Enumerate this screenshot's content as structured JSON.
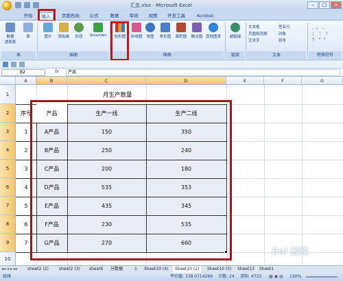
{
  "window": {
    "title": "汇总.xlsx - Microsoft Excel"
  },
  "ribbon_tabs": [
    "开始",
    "插入",
    "页面布局",
    "公式",
    "数据",
    "审阅",
    "视图",
    "开发工具",
    "Acrobat"
  ],
  "ribbon_buttons": {
    "pivot": "数据\n透视表",
    "table": "表",
    "picture": "图片",
    "clipart": "剪贴画",
    "shapes": "形状",
    "smartart": "SmartArt",
    "column": "柱形图",
    "line": "折线图",
    "pie": "饼图",
    "bar": "条形图",
    "area": "面积图",
    "scatter": "散点图",
    "other": "其他图表",
    "hyperlink": "超链接",
    "textbox": "文本框",
    "headerfooter": "页眉和页脚",
    "wordart": "艺术字",
    "signature": "签名行",
    "object": "对象",
    "symbol": "符号"
  },
  "ribbon_groups": {
    "tables": "表",
    "illustrations": "插图",
    "charts": "图表",
    "links": "链接",
    "text": "文本",
    "special": "特殊符号"
  },
  "formula_bar": {
    "name_box": "B2",
    "fx": "fx",
    "value": "产品"
  },
  "columns": [
    "A",
    "B",
    "C",
    "D",
    "E",
    "F",
    "G"
  ],
  "rows": [
    "1",
    "2",
    "3",
    "4",
    "5",
    "6",
    "7",
    "8",
    "9",
    "10"
  ],
  "sheet": {
    "title": "月生产数量",
    "col_a_header": "序号",
    "headers": [
      "产品",
      "生产一线",
      "生产二线"
    ],
    "data": [
      {
        "no": "1",
        "product": "A产品",
        "line1": "150",
        "line2": "350"
      },
      {
        "no": "2",
        "product": "B产品",
        "line1": "250",
        "line2": "240"
      },
      {
        "no": "3",
        "product": "C产品",
        "line1": "200",
        "line2": "180"
      },
      {
        "no": "4",
        "product": "D产品",
        "line1": "535",
        "line2": "353"
      },
      {
        "no": "5",
        "product": "E产品",
        "line1": "435",
        "line2": "345"
      },
      {
        "no": "6",
        "product": "F产品",
        "line1": "230",
        "line2": "535"
      },
      {
        "no": "7",
        "product": "G产品",
        "line1": "270",
        "line2": "660"
      }
    ]
  },
  "sheet_tabs": [
    "sheet2 (2)",
    "sheet2 (3)",
    "sheet6",
    "分数据",
    "1",
    "Sheet10 (4)",
    "Sheet10 (2)",
    "Sheet10 (5)",
    "Sheet13",
    "Sheet1"
  ],
  "status": {
    "ready": "就绪",
    "average": "平均值: 338.0714286",
    "count": "计数: 24",
    "sum": "求和: 4733",
    "zoom": "130%"
  },
  "watermark": "Bai 经验"
}
